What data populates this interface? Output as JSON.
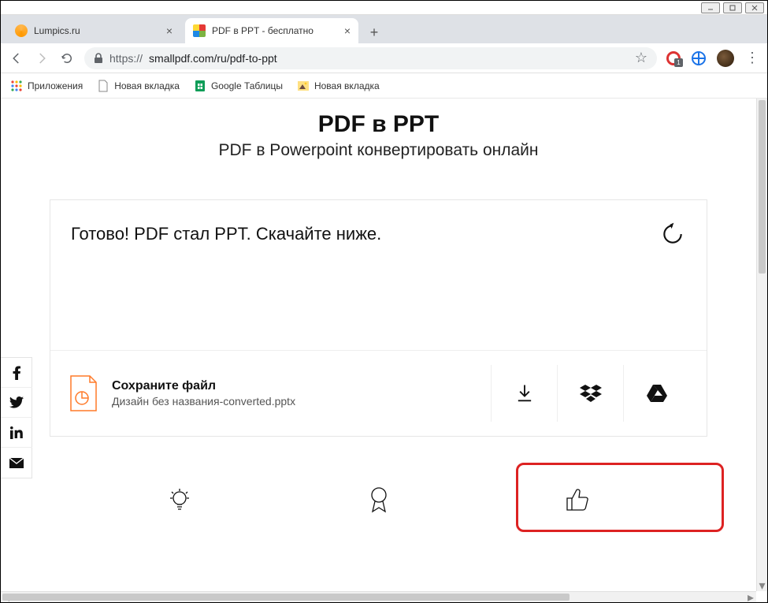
{
  "window": {
    "minimize": "—",
    "maximize": "☐",
    "close": "✕"
  },
  "tabs": {
    "tab1": {
      "title": "Lumpics.ru"
    },
    "tab2": {
      "title": "PDF в PPT - бесплатно"
    }
  },
  "url": {
    "secure": "https://",
    "rest": "smallpdf.com/ru/pdf-to-ppt"
  },
  "extensions": {
    "badge_count": "1"
  },
  "bookmarks": {
    "apps": "Приложения",
    "b1": "Новая вкладка",
    "b2": "Google Таблицы",
    "b3": "Новая вкладка"
  },
  "page": {
    "title": "PDF в PPT",
    "subtitle": "PDF в Powerpoint конвертировать онлайн",
    "status": "Готово! PDF стал PPT. Скачайте ниже.",
    "save_title": "Сохраните файл",
    "filename": "Дизайн без названия-converted.pptx"
  }
}
